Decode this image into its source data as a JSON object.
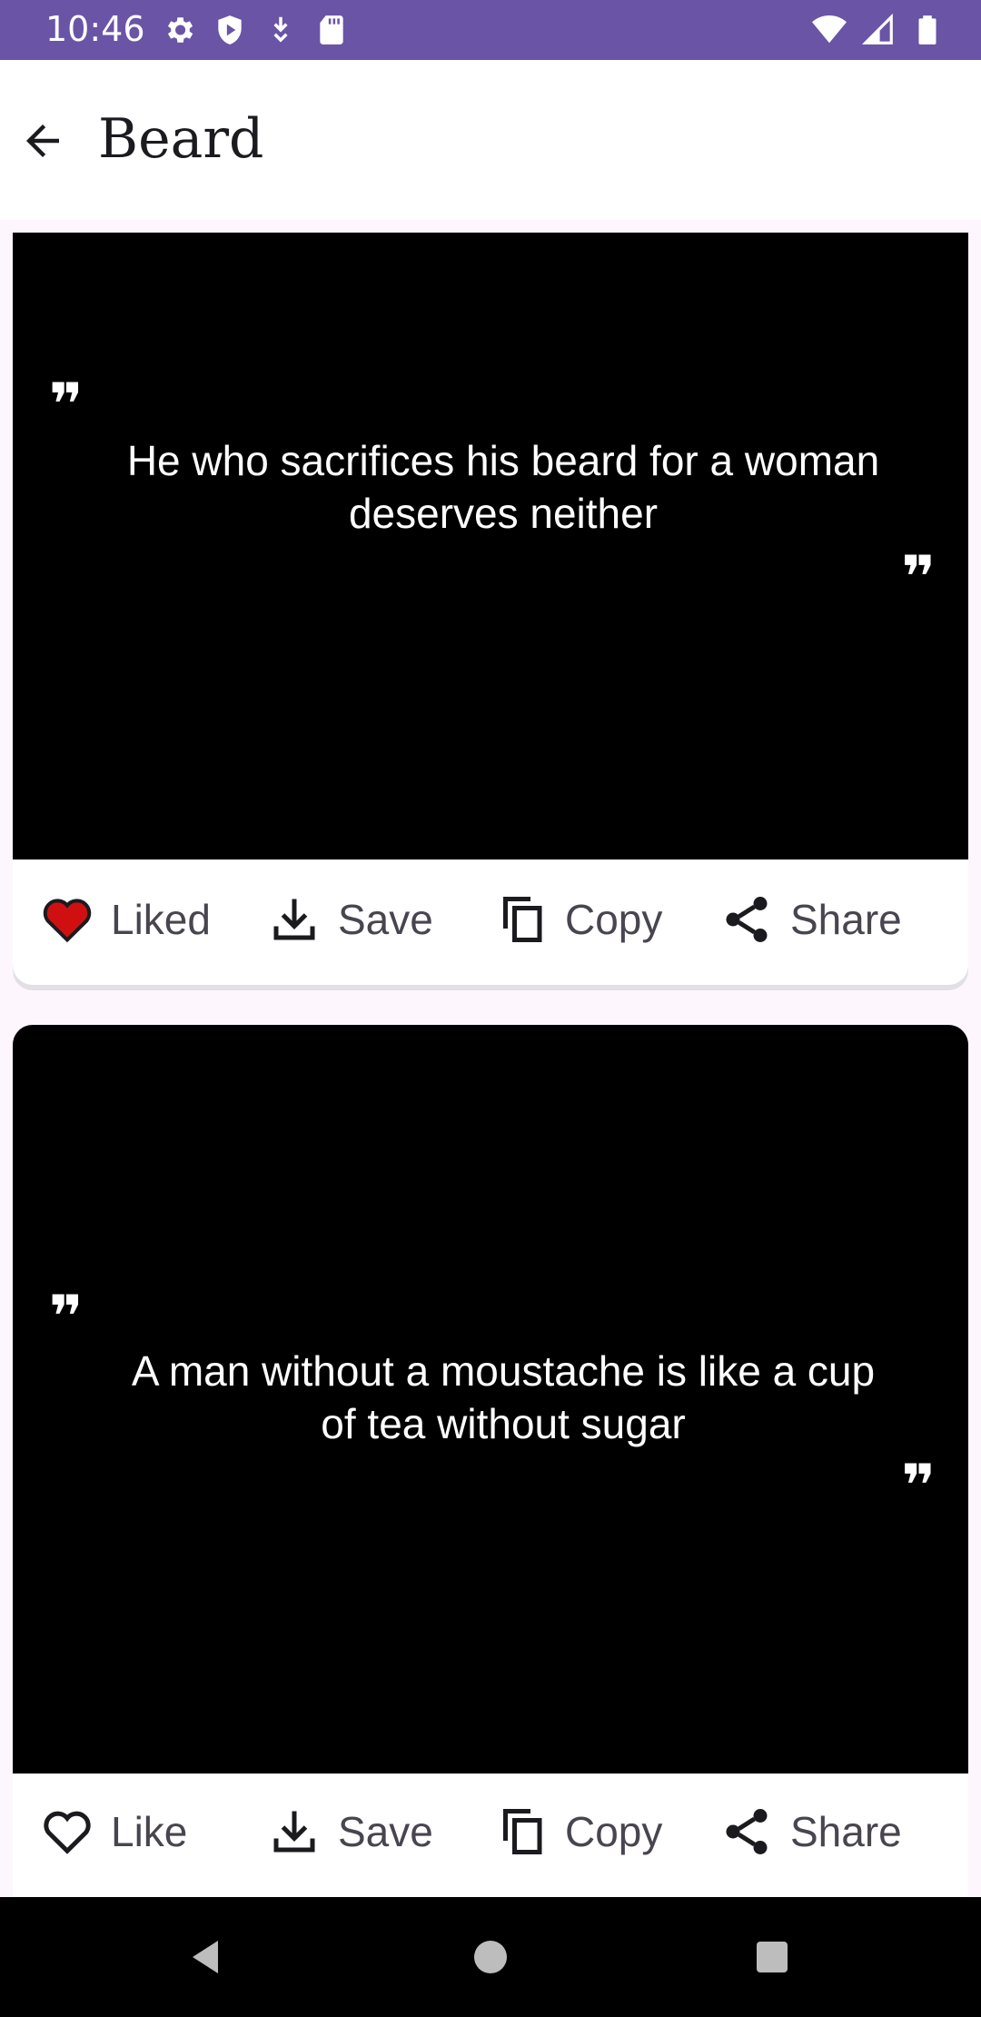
{
  "status_bar": {
    "time": "10:46",
    "left_icons": [
      "settings-icon",
      "shield-icon",
      "download-icon",
      "sd-card-icon"
    ],
    "right_icons": [
      "wifi-icon",
      "signal-icon",
      "battery-icon"
    ],
    "color": "#6a54a5"
  },
  "app_bar": {
    "back_icon": "arrow-back-icon",
    "title": "Beard"
  },
  "quotes": [
    {
      "open_mark": "❞",
      "text": "He who sacrifices his beard for a woman deserves neither",
      "close_mark": "❞",
      "liked": true,
      "like_label": "Liked",
      "save_label": "Save",
      "copy_label": "Copy",
      "share_label": "Share"
    },
    {
      "open_mark": "❞",
      "text": "A man without a moustache is like a cup of tea without sugar",
      "close_mark": "❞",
      "liked": false,
      "like_label": "Like",
      "save_label": "Save",
      "copy_label": "Copy",
      "share_label": "Share"
    }
  ],
  "colors": {
    "liked_heart": "#d01010",
    "card_background": "#000000",
    "action_text": "#49454f"
  },
  "nav_bar": {
    "buttons": [
      "back-triangle-icon",
      "home-circle-icon",
      "recents-square-icon"
    ]
  }
}
